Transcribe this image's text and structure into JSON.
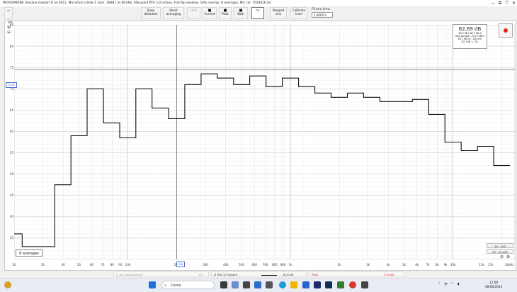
{
  "window": {
    "title": "MICROPHONE (Volume master) R on EXCL: Microfono (Umik-1  Gain: 18dB  ) at 48 kHz, 64k-point RTA 1/3 octave, Flat-Top window, 50% overlap, 8 averages, Mic cal: 7034626.txt",
    "controls": [
      "—",
      "⧉",
      "⤧",
      "✕"
    ]
  },
  "toolbar": {
    "buttons": [
      {
        "label1": "Show",
        "label2": "distortion",
        "enabled": true
      },
      {
        "label1": "Reset",
        "label2": "averaging",
        "enabled": true
      },
      {
        "label1": "Hold",
        "label2": "",
        "enabled": false
      },
      {
        "label1": "Current",
        "label2": "",
        "enabled": true
      },
      {
        "label1": "Peak",
        "label2": "",
        "enabled": true
      },
      {
        "label1": "Both",
        "label2": "",
        "enabled": true
      },
      {
        "label1": "Stepped",
        "label2": "sine",
        "enabled": true
      },
      {
        "label1": "Calibrate",
        "label2": "level",
        "enabled": true
      }
    ],
    "fs_label": "FS sine Vrms",
    "fs_value": "1,0000 V"
  },
  "plot": {
    "y_unit": "SPL",
    "spl_select": "SPL",
    "readout": {
      "value": "82,69 dB",
      "line1": "60,9 dB C  82,7 dB A",
      "line2": "Raw sample: -24,13 dBFS",
      "line3": "82,7 dB 20 - 20k kHz",
      "line4": "82,7 dB < 12k"
    },
    "averages_label": "8 averages",
    "cursor_y_label": "74,52",
    "cursor_x_label": "200",
    "range_buttons": [
      "10 - 200",
      "20 - 20.000"
    ]
  },
  "chart_data": {
    "type": "line",
    "step": true,
    "x_scale": "log",
    "xlim": [
      20,
      24000
    ],
    "ylim": [
      30,
      85
    ],
    "y_ticks": [
      "85",
      "80",
      "75",
      "70",
      "65",
      "60",
      "55",
      "50",
      "45",
      "40",
      "35"
    ],
    "x_ticks": [
      {
        "v": 20,
        "t": "20"
      },
      {
        "v": 30,
        "t": "30"
      },
      {
        "v": 40,
        "t": "40"
      },
      {
        "v": 50,
        "t": "50"
      },
      {
        "v": 60,
        "t": "60"
      },
      {
        "v": 70,
        "t": "70"
      },
      {
        "v": 80,
        "t": "80"
      },
      {
        "v": 90,
        "t": "90"
      },
      {
        "v": 100,
        "t": "100"
      },
      {
        "v": 200,
        "t": "200"
      },
      {
        "v": 300,
        "t": "300"
      },
      {
        "v": 400,
        "t": "400"
      },
      {
        "v": 500,
        "t": "500"
      },
      {
        "v": 600,
        "t": "600"
      },
      {
        "v": 700,
        "t": "700"
      },
      {
        "v": 800,
        "t": "800"
      },
      {
        "v": 900,
        "t": "900"
      },
      {
        "v": 1000,
        "t": "1k"
      },
      {
        "v": 2000,
        "t": "2k"
      },
      {
        "v": 3000,
        "t": "3k"
      },
      {
        "v": 4000,
        "t": "4k"
      },
      {
        "v": 5000,
        "t": "5k"
      },
      {
        "v": 6000,
        "t": "6k"
      },
      {
        "v": 7000,
        "t": "7k"
      },
      {
        "v": 8000,
        "t": "8k"
      },
      {
        "v": 9000,
        "t": "9k"
      },
      {
        "v": 10000,
        "t": "10k"
      },
      {
        "v": 15000,
        "t": "15k"
      },
      {
        "v": 17000,
        "t": "17k"
      },
      {
        "v": 24000,
        "t": "24kHz"
      }
    ],
    "x_edges": [
      20,
      22.4,
      28.2,
      35.5,
      44.7,
      56.2,
      70.8,
      89.1,
      112,
      141,
      178,
      224,
      282,
      355,
      447,
      562,
      708,
      891,
      1122,
      1413,
      1778,
      2239,
      2818,
      3548,
      4467,
      5623,
      7079,
      8913,
      11220,
      14130,
      17780,
      22390
    ],
    "values": [
      36,
      33,
      33,
      47.5,
      59,
      70,
      62,
      58.5,
      70,
      65.5,
      63,
      71,
      73.5,
      72.5,
      71,
      73,
      70.5,
      72.5,
      70.5,
      69,
      68,
      69,
      68,
      67,
      67,
      67.5,
      64,
      57.5,
      55.5,
      56.5,
      52
    ],
    "cursor": {
      "x": 200,
      "y": 74.52
    },
    "legend": [
      {
        "name": "No measurement",
        "value": "80"
      },
      {
        "name": "RTA 1/3 octave",
        "value": "62,8 dB"
      },
      {
        "name": "Peak",
        "value": "71,8 dB"
      }
    ]
  },
  "taskbar": {
    "search_placeholder": "Cerca",
    "time": "12:09",
    "date": "08/08/2024"
  }
}
